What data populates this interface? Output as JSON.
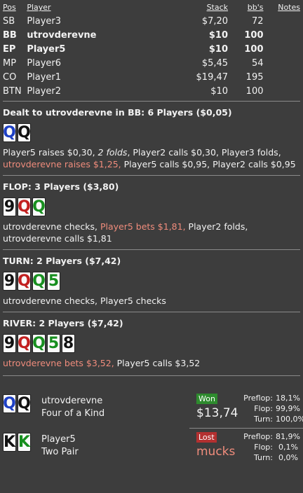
{
  "players_table": {
    "headers": {
      "pos": "Pos",
      "player": "Player",
      "stack": "Stack",
      "bbs": "bb's",
      "notes": "Notes"
    },
    "rows": [
      {
        "pos": "SB",
        "name": "Player3",
        "stack": "$7,20",
        "bbs": "72",
        "bold": false
      },
      {
        "pos": "BB",
        "name": "utrovderevne",
        "stack": "$10",
        "bbs": "100",
        "bold": true
      },
      {
        "pos": "EP",
        "name": "Player5",
        "stack": "$10",
        "bbs": "100",
        "bold": true
      },
      {
        "pos": "MP",
        "name": "Player6",
        "stack": "$5,45",
        "bbs": "54",
        "bold": false
      },
      {
        "pos": "CO",
        "name": "Player1",
        "stack": "$19,47",
        "bbs": "195",
        "bold": false
      },
      {
        "pos": "BTN",
        "name": "Player2",
        "stack": "$10",
        "bbs": "100",
        "bold": false
      }
    ]
  },
  "preflop": {
    "header": "Dealt to utrovderevne in BB: 6 Players ($0,05)",
    "cards": [
      {
        "rank": "Q",
        "suit": "d"
      },
      {
        "rank": "Q",
        "suit": "s"
      }
    ],
    "actions": [
      {
        "text": "Player5 raises $0,30, ",
        "style": ""
      },
      {
        "text": "2 folds",
        "style": "it"
      },
      {
        "text": ", Player2 calls $0,30, Player3 folds, ",
        "style": ""
      },
      {
        "text": "utrovderevne raises $1,25,",
        "style": "hl"
      },
      {
        "text": " Player5 calls $0,95, Player2 calls $0,95",
        "style": ""
      }
    ]
  },
  "flop": {
    "header": "FLOP: 3 Players ($3,80)",
    "cards": [
      {
        "rank": "9",
        "suit": "s"
      },
      {
        "rank": "Q",
        "suit": "h"
      },
      {
        "rank": "Q",
        "suit": "c"
      }
    ],
    "actions": [
      {
        "text": "utrovderevne checks, ",
        "style": ""
      },
      {
        "text": "Player5 bets $1,81,",
        "style": "hl"
      },
      {
        "text": " Player2 folds, utrovderevne calls $1,81",
        "style": ""
      }
    ]
  },
  "turn": {
    "header": "TURN: 2 Players ($7,42)",
    "cards": [
      {
        "rank": "9",
        "suit": "s"
      },
      {
        "rank": "Q",
        "suit": "h"
      },
      {
        "rank": "Q",
        "suit": "c"
      },
      {
        "rank": "5",
        "suit": "c"
      }
    ],
    "actions": [
      {
        "text": "utrovderevne checks, Player5 checks",
        "style": ""
      }
    ]
  },
  "river": {
    "header": "RIVER: 2 Players ($7,42)",
    "cards": [
      {
        "rank": "9",
        "suit": "s"
      },
      {
        "rank": "Q",
        "suit": "h"
      },
      {
        "rank": "Q",
        "suit": "c"
      },
      {
        "rank": "5",
        "suit": "c"
      },
      {
        "rank": "8",
        "suit": "s"
      }
    ],
    "actions": [
      {
        "text": "utrovderevne bets $3,52,",
        "style": "hl"
      },
      {
        "text": " Player5 calls $3,52",
        "style": ""
      }
    ]
  },
  "results": [
    {
      "cards": [
        {
          "rank": "Q",
          "suit": "d"
        },
        {
          "rank": "Q",
          "suit": "s"
        }
      ],
      "name": "utrovderevne",
      "hand": "Four of a Kind",
      "badge": "Won",
      "badge_type": "won",
      "amount": "$13,74",
      "equity": [
        {
          "label": "Preflop:",
          "value": "18,1%"
        },
        {
          "label": "Flop:",
          "value": "99,9%"
        },
        {
          "label": "Turn:",
          "value": "100,0%"
        }
      ]
    },
    {
      "cards": [
        {
          "rank": "K",
          "suit": "s"
        },
        {
          "rank": "K",
          "suit": "c"
        }
      ],
      "name": "Player5",
      "hand": "Two Pair",
      "badge": "Lost",
      "badge_type": "lost",
      "amount": "mucks",
      "equity": [
        {
          "label": "Preflop:",
          "value": "81,9%"
        },
        {
          "label": "Flop:",
          "value": "0,1%"
        },
        {
          "label": "Turn:",
          "value": "0,0%"
        }
      ]
    }
  ],
  "colors": {
    "background": "#3d3d3d",
    "highlight": "#f08c7c",
    "won": "#2e8b2e",
    "lost": "#b33030"
  }
}
